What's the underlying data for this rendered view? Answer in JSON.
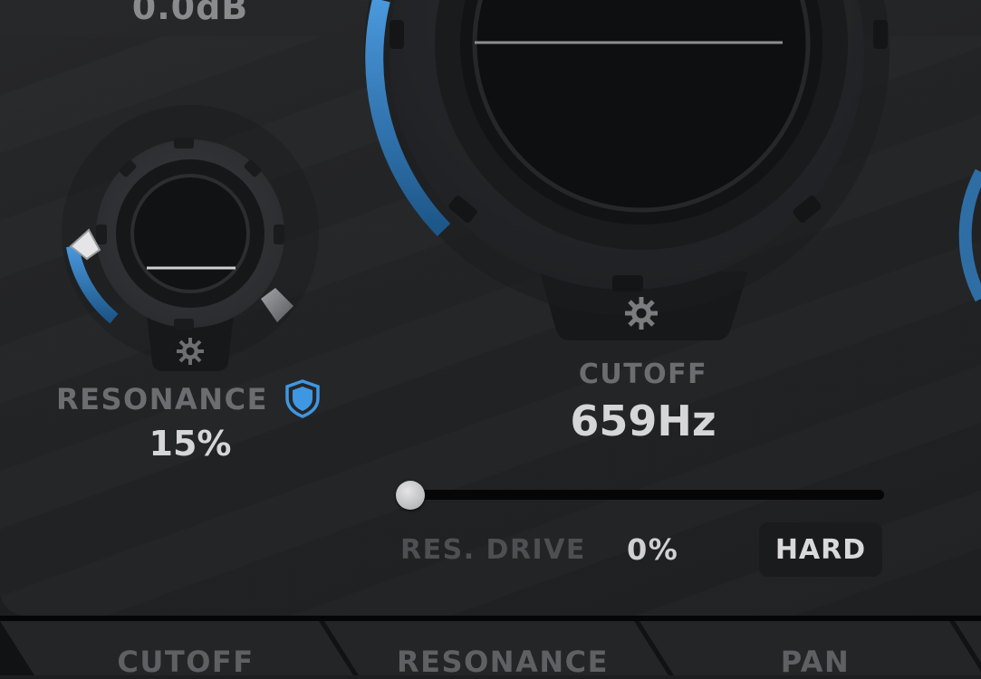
{
  "top": {
    "gain_value": "0.0dB"
  },
  "resonance": {
    "label": "RESONANCE",
    "value": "15%",
    "level": 0.15,
    "shield_icon": "shield-icon",
    "settings_icon": "gear-icon"
  },
  "cutoff": {
    "label": "CUTOFF",
    "value": "659Hz",
    "settings_icon": "gear-icon"
  },
  "res_drive": {
    "label": "RES. DRIVE",
    "value": "0%",
    "level": 0,
    "mode_label": "HARD"
  },
  "tabs": [
    {
      "label": "CUTOFF"
    },
    {
      "label": "RESONANCE"
    },
    {
      "label": "PAN"
    }
  ],
  "colors": {
    "accent_blue": "#3f8fd6",
    "accent_blue_dark": "#1f5a8e",
    "panel": "#232426",
    "label_grey": "#6c6d70"
  }
}
